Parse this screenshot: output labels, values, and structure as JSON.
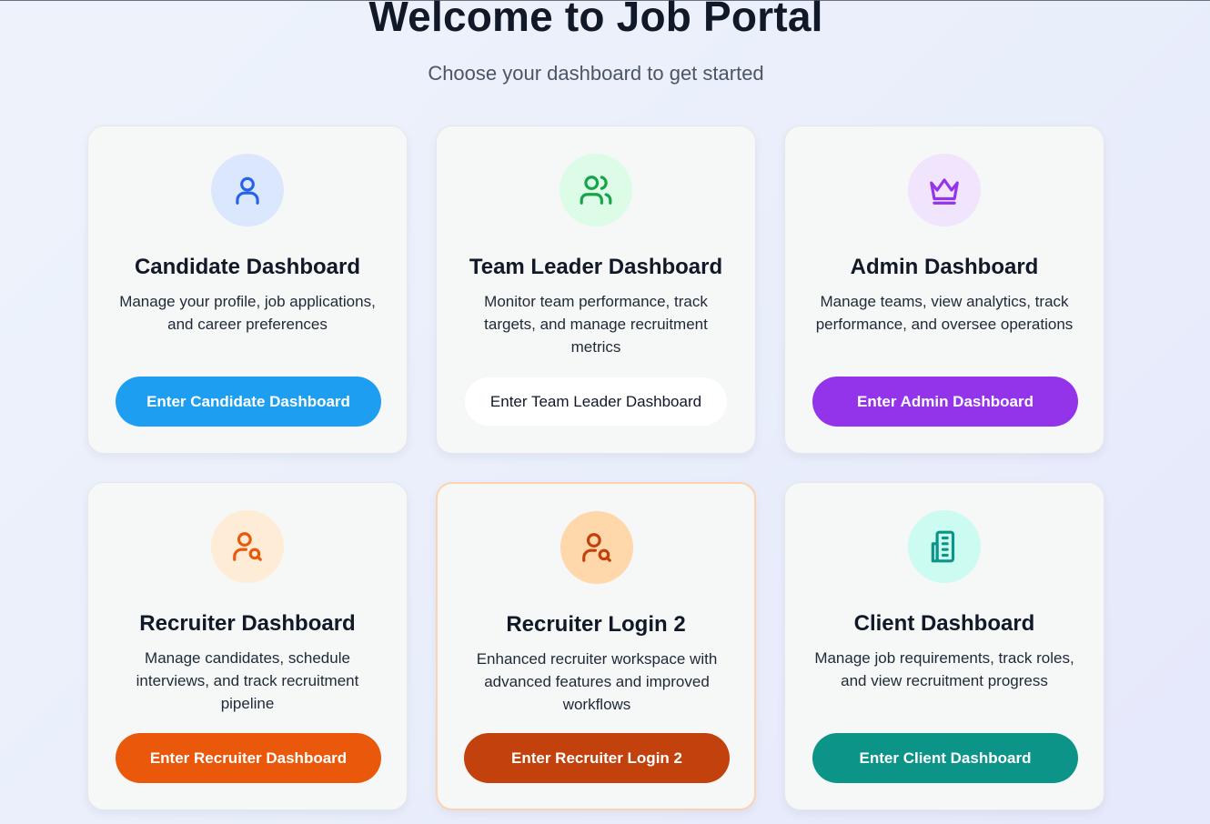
{
  "header": {
    "title": "Welcome to Job Portal",
    "subtitle": "Choose your dashboard to get started"
  },
  "cards": [
    {
      "title": "Candidate Dashboard",
      "description": "Manage your profile, job applications, and career preferences",
      "button": "Enter Candidate Dashboard",
      "icon": "user-icon",
      "icon_color": "#2563eb",
      "icon_bg": "#dbe7fd",
      "button_color": "#1e9ef0"
    },
    {
      "title": "Team Leader Dashboard",
      "description": "Monitor team performance, track targets, and manage recruitment metrics",
      "button": "Enter Team Leader Dashboard",
      "icon": "users-icon",
      "icon_color": "#16a34a",
      "icon_bg": "#dcfce7",
      "button_color": "#ffffff"
    },
    {
      "title": "Admin Dashboard",
      "description": "Manage teams, view analytics, track performance, and oversee operations",
      "button": "Enter Admin Dashboard",
      "icon": "crown-icon",
      "icon_color": "#9333ea",
      "icon_bg": "#f1e4fd",
      "button_color": "#9333ea"
    },
    {
      "title": "Recruiter Dashboard",
      "description": "Manage candidates, schedule interviews, and track recruitment pipeline",
      "button": "Enter Recruiter Dashboard",
      "icon": "user-search-icon",
      "icon_color": "#ea580c",
      "icon_bg": "#ffecd6",
      "button_color": "#ea580c"
    },
    {
      "title": "Recruiter Login 2",
      "description": "Enhanced recruiter workspace with advanced features and improved workflows",
      "button": "Enter Recruiter Login 2",
      "icon": "user-search-icon",
      "icon_color": "#c2410c",
      "icon_bg": "#fed7aa",
      "button_color": "#c2410c"
    },
    {
      "title": "Client Dashboard",
      "description": "Manage job requirements, track roles, and view recruitment progress",
      "button": "Enter Client Dashboard",
      "icon": "building-icon",
      "icon_color": "#0d9488",
      "icon_bg": "#ccfbf1",
      "button_color": "#0d9488"
    }
  ]
}
